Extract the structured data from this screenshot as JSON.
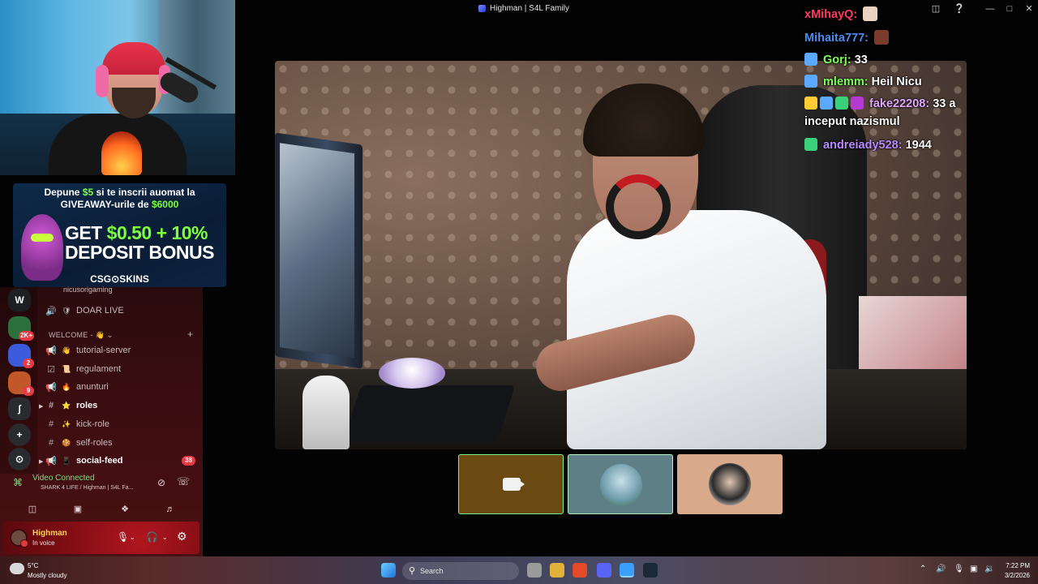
{
  "window": {
    "title": "Highman | S4L Family",
    "controls": [
      "inbox-icon",
      "help-icon",
      "minimize-icon",
      "maximize-icon",
      "close-icon"
    ]
  },
  "ad": {
    "line1_pre": "Depune ",
    "line1_amount": "$5",
    "line1_post": " si te inscrii auomat la",
    "line2_pre": "GIVEAWAY-urile de ",
    "line2_amount": "$6000",
    "big1_pre": "GET ",
    "big1_amount": "$0.50 + 10%",
    "big2": "DEPOSIT BONUS",
    "brand": "CSG⊙SKINS"
  },
  "discord": {
    "rail": [
      {
        "label": "W",
        "color": "#1e1f22",
        "badge": ""
      },
      {
        "label": "",
        "color": "#2b6f3c",
        "badge": "2K+"
      },
      {
        "label": "",
        "color": "#3b5bdb",
        "badge": "2"
      },
      {
        "label": "",
        "color": "#c2582a",
        "badge": "9"
      },
      {
        "label": "ʃ",
        "color": "#2a2b2f",
        "badge": ""
      },
      {
        "label": "+",
        "color": "#2a2b2f",
        "badge": ""
      },
      {
        "label": "⊙",
        "color": "#2a2b2f",
        "badge": ""
      }
    ],
    "voice_user": "nicusorigaming",
    "channels_top": [
      {
        "icon": "🔊",
        "emoji": "🛡",
        "name": "DOAR LIVE"
      }
    ],
    "category": "WELCOME - 👋",
    "channels": [
      {
        "icon": "📢",
        "emoji": "👋",
        "name": "tutorial-server",
        "bold": false,
        "badge": ""
      },
      {
        "icon": "☑",
        "emoji": "📜",
        "name": "regulament",
        "bold": false,
        "badge": ""
      },
      {
        "icon": "📢",
        "emoji": "🔥",
        "name": "anunturi",
        "bold": false,
        "badge": ""
      },
      {
        "icon": "#",
        "emoji": "⭐",
        "name": "roles",
        "bold": true,
        "badge": ""
      },
      {
        "icon": "#",
        "emoji": "✨",
        "name": "kick-role",
        "bold": false,
        "badge": ""
      },
      {
        "icon": "#",
        "emoji": "🍪",
        "name": "self-roles",
        "bold": false,
        "badge": ""
      },
      {
        "icon": "📢",
        "emoji": "📱",
        "name": "social-feed",
        "bold": true,
        "badge": "38"
      }
    ],
    "voice": {
      "status": "Video Connected",
      "location": "SHARK 4 LIFE / Highman | S4L Fa..."
    },
    "user": {
      "name": "Highman",
      "status": "In voice"
    }
  },
  "chat": [
    {
      "user": "xMihayQ:",
      "color": "#ff3b5c",
      "text": "",
      "badges": [],
      "emote": "#e9d3c0"
    },
    {
      "user": "Mihaita777:",
      "color": "#4a8df0",
      "text": "",
      "badges": [],
      "emote": "#7a3b2d"
    },
    {
      "user": "Gorj:",
      "color": "#7cff5a",
      "text": "33",
      "badges": [
        "#5aa9ff"
      ],
      "emote": ""
    },
    {
      "user": "mlemm:",
      "color": "#7cff5a",
      "text": "Heil Nicu",
      "badges": [
        "#5aa9ff"
      ],
      "emote": ""
    },
    {
      "user": "fake22208:",
      "color": "#e0a7ff",
      "text": "33 a",
      "badges": [
        "#ffcc33",
        "#5aa9ff",
        "#3bd17a",
        "#b33bd1"
      ],
      "emote": ""
    },
    {
      "user": "",
      "color": "#ffffff",
      "text": "inceput nazismul",
      "badges": [],
      "emote": ""
    },
    {
      "user": "andreiady528:",
      "color": "#b98bff",
      "text": "1944",
      "badges": [
        "#3bd17a"
      ],
      "emote": ""
    }
  ],
  "participants": [
    {
      "kind": "camera-off",
      "bg": "#6b4a12",
      "border": "#7cf08a"
    },
    {
      "kind": "avatar",
      "bg": "#5f7f86",
      "border": "#b9f0c0",
      "avatar": "#9db9c4"
    },
    {
      "kind": "avatar",
      "bg": "#d9a98b",
      "border": "#d9a98b",
      "avatar": "#2a2a2a"
    }
  ],
  "taskbar": {
    "temp": "5°C",
    "weather": "Mostly cloudy",
    "search_placeholder": "Search",
    "apps": [
      "#3a7bd5",
      "#9a9a9a",
      "#e0b23a",
      "#e24a2a",
      "#5865f2",
      "#3aa0ff",
      "#1b2838"
    ],
    "time": "7:22 PM",
    "date": "3/2/2026"
  }
}
